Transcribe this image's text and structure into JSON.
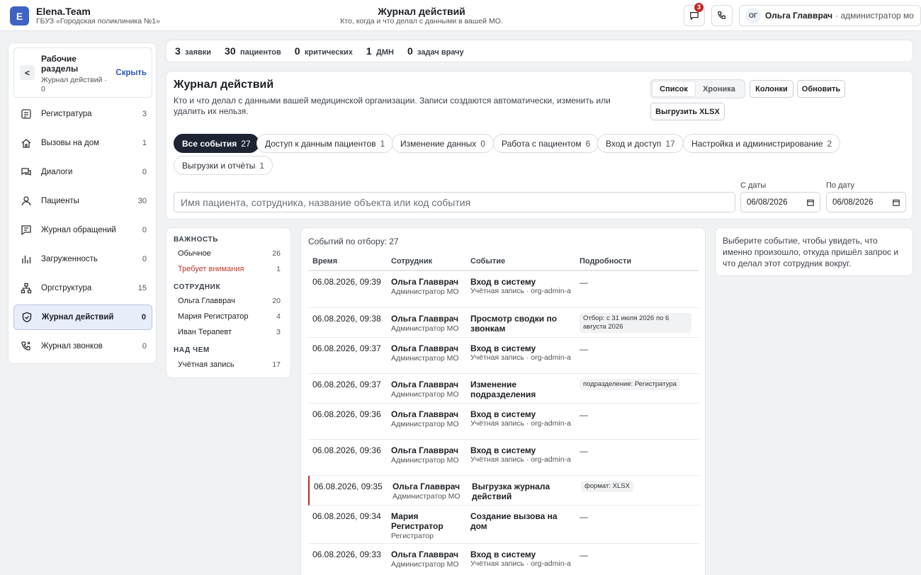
{
  "brand": {
    "logo_letter": "E",
    "name": "Elena.Team",
    "org": "ГБУЗ «Городская поликлиника №1»"
  },
  "header": {
    "title": "Журнал действий",
    "subtitle": "Кто, когда и что делал с данными в вашей МО.",
    "messages_badge": "3"
  },
  "user": {
    "initials": "ОГ",
    "name": "Ольга Главврач",
    "role": "· администратор мо"
  },
  "sidebar": {
    "back": "<",
    "title": "Рабочие разделы",
    "crumb": "Журнал действий · 0",
    "hide": "Скрыть",
    "items": [
      {
        "label": "Регистратура",
        "count": "3",
        "icon": "registry-icon"
      },
      {
        "label": "Вызовы на дом",
        "count": "1",
        "icon": "home-icon"
      },
      {
        "label": "Диалоги",
        "count": "0",
        "icon": "chat-icon"
      },
      {
        "label": "Пациенты",
        "count": "30",
        "icon": "person-icon"
      },
      {
        "label": "Журнал обращений",
        "count": "0",
        "icon": "message-icon"
      },
      {
        "label": "Загруженность",
        "count": "0",
        "icon": "bar-chart-icon"
      },
      {
        "label": "Оргструктура",
        "count": "15",
        "icon": "org-tree-icon"
      },
      {
        "label": "Журнал действий",
        "count": "0",
        "icon": "shield-icon",
        "active": true
      },
      {
        "label": "Журнал звонков",
        "count": "0",
        "icon": "phone-icon"
      }
    ]
  },
  "stats": [
    {
      "value": "3",
      "label": "заявки"
    },
    {
      "value": "30",
      "label": "пациентов"
    },
    {
      "value": "0",
      "label": "критических"
    },
    {
      "value": "1",
      "label": "ДМН"
    },
    {
      "value": "0",
      "label": "задач врачу"
    }
  ],
  "main": {
    "title": "Журнал действий",
    "description": "Кто и что делал с данными вашей медицинской организации. Записи создаются автоматически, изменить или удалить их нельзя.",
    "view_list": "Список",
    "view_timeline": "Хроника",
    "columns_btn": "Колонки",
    "refresh_btn": "Обновить",
    "export_btn": "Выгрузить XLSX",
    "chips": [
      {
        "label": "Все события",
        "count": "27",
        "active": true
      },
      {
        "label": "Доступ к данным пациентов",
        "count": "1"
      },
      {
        "label": "Изменение данных",
        "count": "0"
      },
      {
        "label": "Работа с пациентом",
        "count": "6"
      },
      {
        "label": "Вход и доступ",
        "count": "17"
      },
      {
        "label": "Настройка и администрирование",
        "count": "2"
      },
      {
        "label": "Выгрузки и отчёты",
        "count": "1"
      }
    ],
    "search_placeholder": "Имя пациента, сотрудника, название объекта или код события",
    "date_from_label": "С даты",
    "date_to_label": "По дату",
    "date_from": "06/08/2026",
    "date_to": "06/08/2026"
  },
  "filters": {
    "importance_title": "ВАЖНОСТЬ",
    "importance": [
      {
        "label": "Обычное",
        "count": "26"
      },
      {
        "label": "Требует внимания",
        "count": "1",
        "warn": true
      }
    ],
    "employee_title": "СОТРУДНИК",
    "employees": [
      {
        "label": "Ольга Главврач",
        "count": "20"
      },
      {
        "label": "Мария Регистратор",
        "count": "4"
      },
      {
        "label": "Иван Терапевт",
        "count": "3"
      }
    ],
    "object_title": "НАД ЧЕМ",
    "objects": [
      {
        "label": "Учётная запись",
        "count": "17"
      }
    ]
  },
  "table": {
    "count_text": "Событий по отбору: 27",
    "headers": {
      "time": "Время",
      "employee": "Сотрудник",
      "event": "Событие",
      "details": "Подробности"
    },
    "rows": [
      {
        "time": "06.08.2026, 09:39",
        "emp": "Ольга Главврач",
        "emp_role": "Администратор МО",
        "event": "Вход в систему",
        "event_sub": "Учётная запись · org-admin-a",
        "details": "—"
      },
      {
        "time": "06.08.2026, 09:38",
        "emp": "Ольга Главврач",
        "emp_role": "Администратор МО",
        "event": "Просмотр сводки по звонкам",
        "event_sub": "",
        "tag": "Отбор: с 31 июля 2026 по 6 августа 2026"
      },
      {
        "time": "06.08.2026, 09:37",
        "emp": "Ольга Главврач",
        "emp_role": "Администратор МО",
        "event": "Вход в систему",
        "event_sub": "Учётная запись · org-admin-a",
        "details": "—"
      },
      {
        "time": "06.08.2026, 09:37",
        "emp": "Ольга Главврач",
        "emp_role": "Администратор МО",
        "event": "Изменение подразделения",
        "event_sub": "",
        "tag": "подразделение: Регистратура"
      },
      {
        "time": "06.08.2026, 09:36",
        "emp": "Ольга Главврач",
        "emp_role": "Администратор МО",
        "event": "Вход в систему",
        "event_sub": "Учётная запись · org-admin-a",
        "details": "—"
      },
      {
        "time": "06.08.2026, 09:36",
        "emp": "Ольга Главврач",
        "emp_role": "Администратор МО",
        "event": "Вход в систему",
        "event_sub": "Учётная запись · org-admin-a",
        "details": "—"
      },
      {
        "time": "06.08.2026, 09:35",
        "emp": "Ольга Главврач",
        "emp_role": "Администратор МО",
        "event": "Выгрузка журнала действий",
        "event_sub": "",
        "tag": "формат: XLSX",
        "flag": true
      },
      {
        "time": "06.08.2026, 09:34",
        "emp": "Мария Регистратор",
        "emp_role": "Регистратор",
        "event": "Создание вызова на дом",
        "event_sub": "",
        "details": "—"
      },
      {
        "time": "06.08.2026, 09:33",
        "emp": "Ольга Главврач",
        "emp_role": "Администратор МО",
        "event": "Вход в систему",
        "event_sub": "Учётная запись · org-admin-a",
        "details": "—"
      }
    ]
  },
  "info": {
    "text": "Выберите событие, чтобы увидеть, что именно произошло, откуда пришёл запрос и что делал этот сотрудник вокруг."
  }
}
